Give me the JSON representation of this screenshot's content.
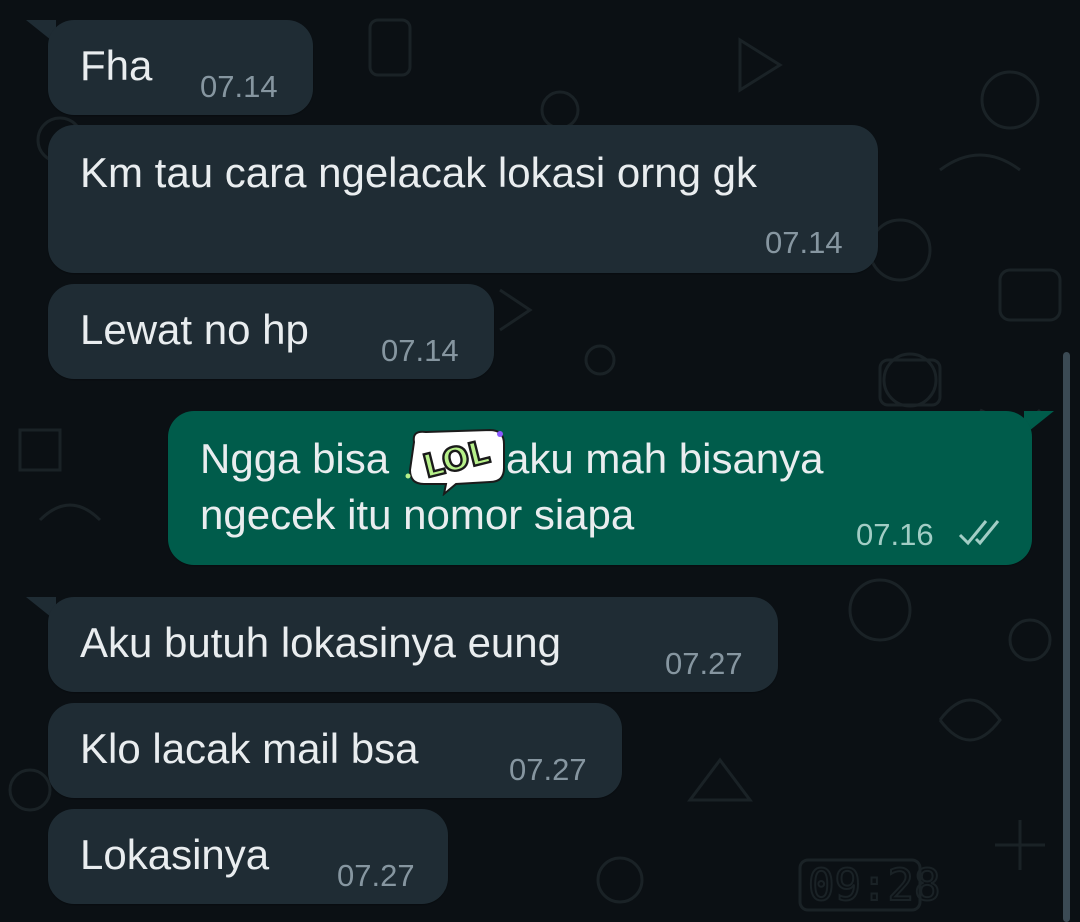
{
  "messages": [
    {
      "direction": "incoming",
      "text": "Fha",
      "time": "07.14"
    },
    {
      "direction": "incoming",
      "text": "Km tau cara ngelacak lokasi orng gk",
      "time": "07.14"
    },
    {
      "direction": "incoming",
      "text": "Lewat no hp",
      "time": "07.14"
    },
    {
      "direction": "outgoing",
      "line1": "Ngga bisa",
      "line1b": "aku mah bisanya",
      "line2": "ngecek itu nomor siapa",
      "time": "07.16",
      "status": "read",
      "sticker": "LOL"
    },
    {
      "direction": "incoming",
      "text": "Aku butuh lokasinya eung",
      "time": "07.27"
    },
    {
      "direction": "incoming",
      "text": "Klo lacak mail bsa",
      "time": "07.27"
    },
    {
      "direction": "incoming",
      "text": "Lokasinya",
      "time": "07.27"
    }
  ],
  "colors": {
    "background": "#0b1014",
    "incoming_bubble": "#1f2c34",
    "outgoing_bubble": "#005c4b",
    "text": "#e9edef",
    "timestamp": "#8696a0",
    "read_ticks": "#a2cdc5"
  },
  "wallpaper_clock": "09:28"
}
